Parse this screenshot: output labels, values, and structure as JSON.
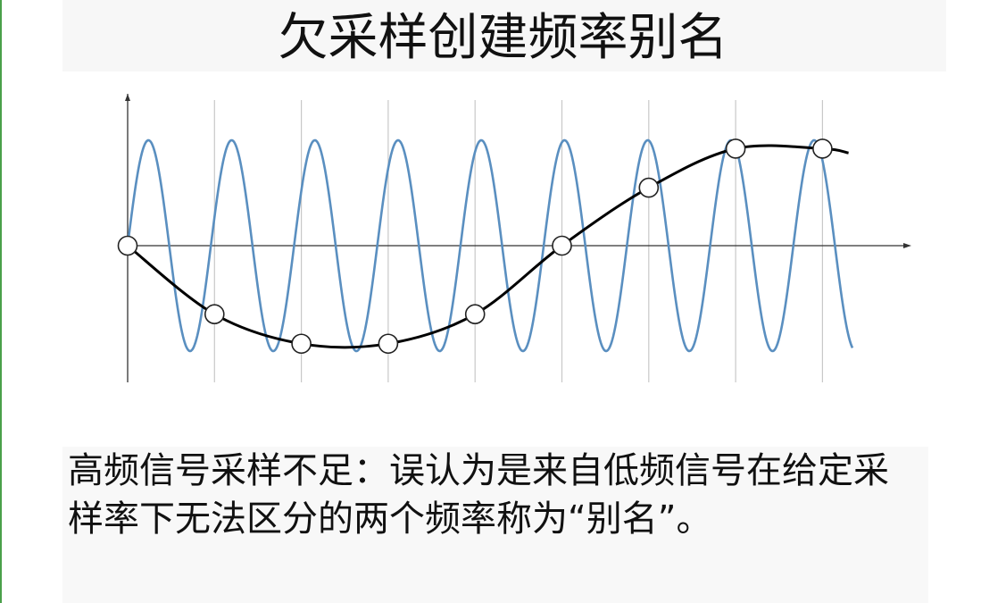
{
  "title": "欠采样创建频率别名",
  "caption": "高频信号采样不足：误认为是来自低频信号在给定采样率下无法区分的两个频率称为“别名”。",
  "chart_data": {
    "type": "line",
    "series": [
      {
        "kind": "high-frequency-signal",
        "cycles": 8.35,
        "amplitude": 1.0,
        "color": "#5a8fc0"
      },
      {
        "kind": "alias-signal",
        "cycles": 0.85,
        "amplitude": 0.95,
        "color": "#000000"
      }
    ],
    "sample_points": [
      {
        "t": 0,
        "v": 0.0
      },
      {
        "t": 1,
        "v": -0.65
      },
      {
        "t": 2,
        "v": -0.93
      },
      {
        "t": 3,
        "v": -0.93
      },
      {
        "t": 4,
        "v": -0.65
      },
      {
        "t": 5,
        "v": 0.0
      },
      {
        "t": 6,
        "v": 0.55
      },
      {
        "t": 7,
        "v": 0.92
      },
      {
        "t": 8,
        "v": 0.92
      }
    ],
    "sample_count": 9,
    "grid_lines": 8,
    "colors": {
      "high_frequency": "#5a8fc0",
      "alias": "#000000",
      "grid": "#c8c8c8",
      "axis": "#333333"
    }
  }
}
